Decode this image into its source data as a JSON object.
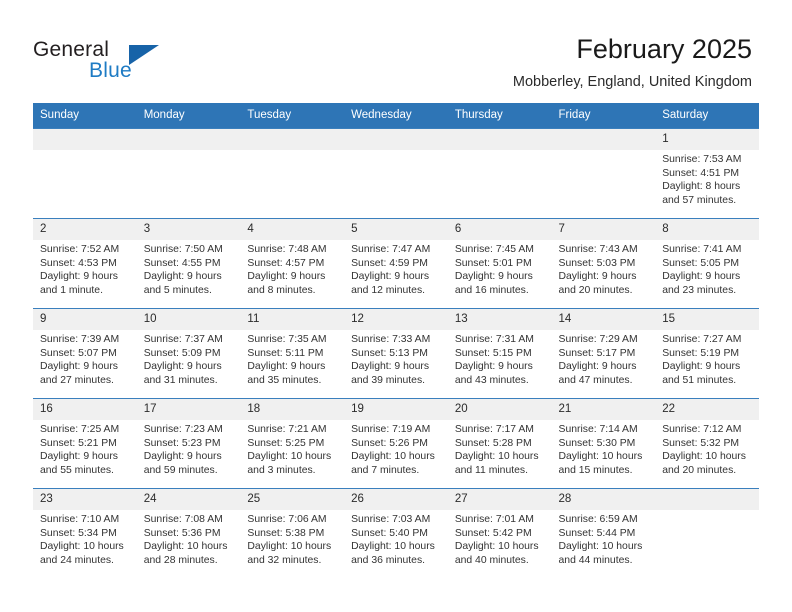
{
  "brand": {
    "name_top": "General",
    "name_bottom": "Blue",
    "triangle_color": "#1763a8",
    "blue_color": "#1e7bc4"
  },
  "header": {
    "title": "February 2025",
    "subtitle": "Mobberley, England, United Kingdom",
    "header_bg_color": "#2e75b6",
    "row_divider_color": "#3a7fbd",
    "daynum_bg_color": "#f0f0f0"
  },
  "weekday_headers": [
    "Sunday",
    "Monday",
    "Tuesday",
    "Wednesday",
    "Thursday",
    "Friday",
    "Saturday"
  ],
  "weeks": [
    [
      {
        "day": "",
        "lines": []
      },
      {
        "day": "",
        "lines": []
      },
      {
        "day": "",
        "lines": []
      },
      {
        "day": "",
        "lines": []
      },
      {
        "day": "",
        "lines": []
      },
      {
        "day": "",
        "lines": []
      },
      {
        "day": "1",
        "lines": [
          "Sunrise: 7:53 AM",
          "Sunset: 4:51 PM",
          "Daylight: 8 hours",
          "and 57 minutes."
        ]
      }
    ],
    [
      {
        "day": "2",
        "lines": [
          "Sunrise: 7:52 AM",
          "Sunset: 4:53 PM",
          "Daylight: 9 hours",
          "and 1 minute."
        ]
      },
      {
        "day": "3",
        "lines": [
          "Sunrise: 7:50 AM",
          "Sunset: 4:55 PM",
          "Daylight: 9 hours",
          "and 5 minutes."
        ]
      },
      {
        "day": "4",
        "lines": [
          "Sunrise: 7:48 AM",
          "Sunset: 4:57 PM",
          "Daylight: 9 hours",
          "and 8 minutes."
        ]
      },
      {
        "day": "5",
        "lines": [
          "Sunrise: 7:47 AM",
          "Sunset: 4:59 PM",
          "Daylight: 9 hours",
          "and 12 minutes."
        ]
      },
      {
        "day": "6",
        "lines": [
          "Sunrise: 7:45 AM",
          "Sunset: 5:01 PM",
          "Daylight: 9 hours",
          "and 16 minutes."
        ]
      },
      {
        "day": "7",
        "lines": [
          "Sunrise: 7:43 AM",
          "Sunset: 5:03 PM",
          "Daylight: 9 hours",
          "and 20 minutes."
        ]
      },
      {
        "day": "8",
        "lines": [
          "Sunrise: 7:41 AM",
          "Sunset: 5:05 PM",
          "Daylight: 9 hours",
          "and 23 minutes."
        ]
      }
    ],
    [
      {
        "day": "9",
        "lines": [
          "Sunrise: 7:39 AM",
          "Sunset: 5:07 PM",
          "Daylight: 9 hours",
          "and 27 minutes."
        ]
      },
      {
        "day": "10",
        "lines": [
          "Sunrise: 7:37 AM",
          "Sunset: 5:09 PM",
          "Daylight: 9 hours",
          "and 31 minutes."
        ]
      },
      {
        "day": "11",
        "lines": [
          "Sunrise: 7:35 AM",
          "Sunset: 5:11 PM",
          "Daylight: 9 hours",
          "and 35 minutes."
        ]
      },
      {
        "day": "12",
        "lines": [
          "Sunrise: 7:33 AM",
          "Sunset: 5:13 PM",
          "Daylight: 9 hours",
          "and 39 minutes."
        ]
      },
      {
        "day": "13",
        "lines": [
          "Sunrise: 7:31 AM",
          "Sunset: 5:15 PM",
          "Daylight: 9 hours",
          "and 43 minutes."
        ]
      },
      {
        "day": "14",
        "lines": [
          "Sunrise: 7:29 AM",
          "Sunset: 5:17 PM",
          "Daylight: 9 hours",
          "and 47 minutes."
        ]
      },
      {
        "day": "15",
        "lines": [
          "Sunrise: 7:27 AM",
          "Sunset: 5:19 PM",
          "Daylight: 9 hours",
          "and 51 minutes."
        ]
      }
    ],
    [
      {
        "day": "16",
        "lines": [
          "Sunrise: 7:25 AM",
          "Sunset: 5:21 PM",
          "Daylight: 9 hours",
          "and 55 minutes."
        ]
      },
      {
        "day": "17",
        "lines": [
          "Sunrise: 7:23 AM",
          "Sunset: 5:23 PM",
          "Daylight: 9 hours",
          "and 59 minutes."
        ]
      },
      {
        "day": "18",
        "lines": [
          "Sunrise: 7:21 AM",
          "Sunset: 5:25 PM",
          "Daylight: 10 hours",
          "and 3 minutes."
        ]
      },
      {
        "day": "19",
        "lines": [
          "Sunrise: 7:19 AM",
          "Sunset: 5:26 PM",
          "Daylight: 10 hours",
          "and 7 minutes."
        ]
      },
      {
        "day": "20",
        "lines": [
          "Sunrise: 7:17 AM",
          "Sunset: 5:28 PM",
          "Daylight: 10 hours",
          "and 11 minutes."
        ]
      },
      {
        "day": "21",
        "lines": [
          "Sunrise: 7:14 AM",
          "Sunset: 5:30 PM",
          "Daylight: 10 hours",
          "and 15 minutes."
        ]
      },
      {
        "day": "22",
        "lines": [
          "Sunrise: 7:12 AM",
          "Sunset: 5:32 PM",
          "Daylight: 10 hours",
          "and 20 minutes."
        ]
      }
    ],
    [
      {
        "day": "23",
        "lines": [
          "Sunrise: 7:10 AM",
          "Sunset: 5:34 PM",
          "Daylight: 10 hours",
          "and 24 minutes."
        ]
      },
      {
        "day": "24",
        "lines": [
          "Sunrise: 7:08 AM",
          "Sunset: 5:36 PM",
          "Daylight: 10 hours",
          "and 28 minutes."
        ]
      },
      {
        "day": "25",
        "lines": [
          "Sunrise: 7:06 AM",
          "Sunset: 5:38 PM",
          "Daylight: 10 hours",
          "and 32 minutes."
        ]
      },
      {
        "day": "26",
        "lines": [
          "Sunrise: 7:03 AM",
          "Sunset: 5:40 PM",
          "Daylight: 10 hours",
          "and 36 minutes."
        ]
      },
      {
        "day": "27",
        "lines": [
          "Sunrise: 7:01 AM",
          "Sunset: 5:42 PM",
          "Daylight: 10 hours",
          "and 40 minutes."
        ]
      },
      {
        "day": "28",
        "lines": [
          "Sunrise: 6:59 AM",
          "Sunset: 5:44 PM",
          "Daylight: 10 hours",
          "and 44 minutes."
        ]
      },
      {
        "day": "",
        "lines": []
      }
    ]
  ]
}
